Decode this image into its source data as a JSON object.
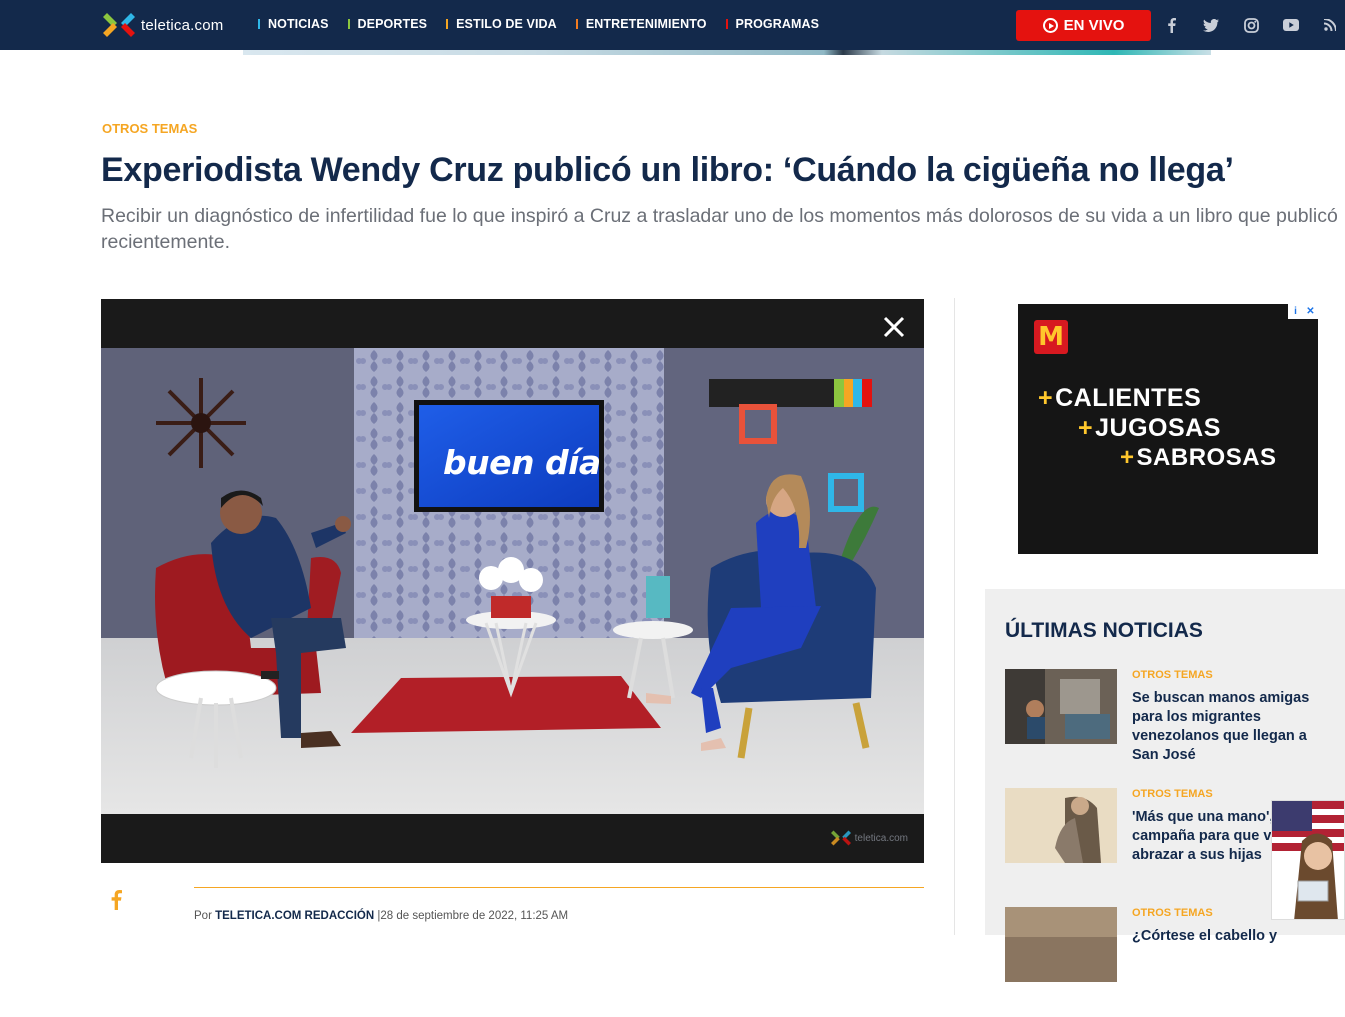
{
  "nav": {
    "logo_text": "teletica.com",
    "menu": [
      {
        "label": "NOTICIAS",
        "color": "#2fb7e8"
      },
      {
        "label": "DEPORTES",
        "color": "#8cc63f"
      },
      {
        "label": "ESTILO DE VIDA",
        "color": "#f5a623"
      },
      {
        "label": "ENTRETENIMIENTO",
        "color": "#f47c20"
      },
      {
        "label": "PROGRAMAS",
        "color": "#e4120f"
      }
    ],
    "live_label": "EN VIVO",
    "social_icons": [
      "facebook-icon",
      "twitter-icon",
      "instagram-icon",
      "youtube-icon",
      "rss-icon"
    ]
  },
  "article": {
    "category": "OTROS TEMAS",
    "title": "Experiodista Wendy Cruz publicó un libro: ‘Cuándo la cigüeña no llega’",
    "subtitle": "Recibir un diagnóstico de infertilidad fue lo que inspiró a Cruz a trasladar uno de los momentos más dolorosos de su vida a un libro que publicó recientemente.",
    "byline_prefix": "Por ",
    "author": "TELETICA.COM REDACCIÓN",
    "date": "|28 de septiembre de 2022, 11:25 AM"
  },
  "video": {
    "screen_text": "buen día",
    "watermark": "teletica.com"
  },
  "ad": {
    "brand_letter": "M",
    "lines": [
      "CALIENTES",
      "JUGOSAS",
      "SABROSAS"
    ]
  },
  "latest": {
    "heading": "ÚLTIMAS NOTICIAS",
    "items": [
      {
        "category": "OTROS TEMAS",
        "title": "Se buscan manos amigas para los migrantes venezolanos que llegan a San José"
      },
      {
        "category": "OTROS TEMAS",
        "title": "'Más que una mano', campaña para que vuelva a abrazar a sus hijas"
      },
      {
        "category": "OTROS TEMAS",
        "title": "¿Córtese el cabello y"
      }
    ]
  }
}
